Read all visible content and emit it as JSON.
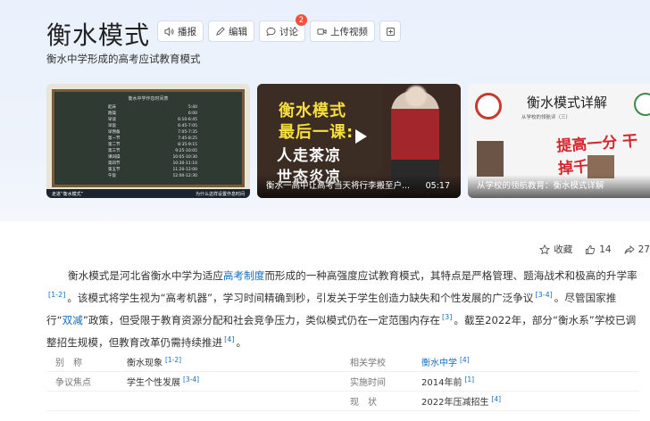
{
  "header": {
    "title": "衡水模式",
    "subtitle": "衡水中学形成的高考应试教育模式",
    "buttons": {
      "play": "播报",
      "edit": "编辑",
      "discuss": "讨论",
      "discuss_badge": "2",
      "upload": "上传视频"
    }
  },
  "media": {
    "board": {
      "heading": "衡水中学作息时间表",
      "rows": [
        [
          "起床",
          "5:40"
        ],
        [
          "跑操",
          "6:00"
        ],
        [
          "早读",
          "6:10-6:45"
        ],
        [
          "早饭",
          "6:45-7:05"
        ],
        [
          "早预备",
          "7:05-7:35"
        ],
        [
          "第一节",
          "7:45-8:25"
        ],
        [
          "第二节",
          "8:35-9:15"
        ],
        [
          "第三节",
          "9:25-10:05"
        ],
        [
          "课间操",
          "10:05-10:30"
        ],
        [
          "第四节",
          "10:30-11:10"
        ],
        [
          "第五节",
          "11:20-12:00"
        ],
        [
          "午饭",
          "12:00-12:30"
        ]
      ],
      "footer_left": "走进“衡水模式”",
      "footer_right": "为什么这样设置作息时间"
    },
    "video": {
      "line1": "衡水模式",
      "line2": "最后一课:",
      "line3": "人走茶凉",
      "line4": "世态炎凉",
      "caption": "衡水一高中让高考当天将行李搬至户...",
      "duration": "05:17"
    },
    "poster": {
      "title": "衡水模式详解",
      "sub": "从学校的领航评（三）",
      "red_text": "提高一分 干掉千人",
      "caption": "从学校的领航教育：衡水模式详解"
    }
  },
  "actions": {
    "favorite": "收藏",
    "like_count": "14",
    "share_count": "27"
  },
  "summary": {
    "p1": "衡水模式是河北省衡水中学为适应",
    "link1": "高考制度",
    "p2": "而形成的一种高强度应试教育模式，其特点是严格管理、题海战术和极高的升学率",
    "ref1": "[1-2]",
    "p3": "。该模式将学生视为“高考机器”，学习时间精确到秒，引发关于学生创造力缺失和个性发展的广泛争议",
    "ref2": "[3-4]",
    "p4": "。尽管国家推行“",
    "link2": "双减",
    "p5": "”政策，但受限于教育资源分配和社会竞争压力，类似模式仍在一定范围内存在",
    "ref3": "[3]",
    "p6": "。截至2022年，部分“衡水系”学校已调整招生规模，但教育改革仍需持续推进",
    "ref4": "[4]",
    "p7": "。"
  },
  "info": {
    "alias_key": "别　称",
    "alias_val": "衡水现象",
    "alias_ref": "[1-2]",
    "school_key": "相关学校",
    "school_val": "衡水中学",
    "school_ref": "[4]",
    "focus_key": "争议焦点",
    "focus_val": "学生个性发展",
    "focus_ref": "[3-4]",
    "time_key": "实施时间",
    "time_val": "2014年前",
    "time_ref": "[1]",
    "status_key": "现　状",
    "status_val": "2022年压减招生",
    "status_ref": "[4]"
  }
}
